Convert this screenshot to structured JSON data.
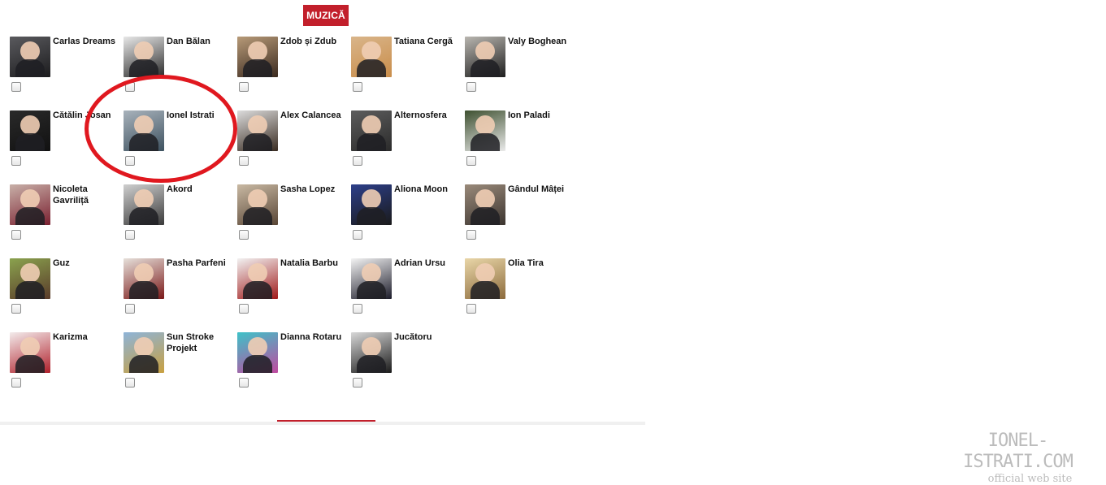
{
  "section": {
    "title": "MUZICĂ"
  },
  "artists": [
    {
      "name": "Carlas Dreams",
      "thumb": [
        "#5a5a5e",
        "#1c1c1e"
      ],
      "checked": false
    },
    {
      "name": "Dan Bălan",
      "thumb": [
        "#e8e8e8",
        "#2a2a2a"
      ],
      "checked": false
    },
    {
      "name": "Zdob și Zdub",
      "thumb": [
        "#b79a78",
        "#3b2a1f"
      ],
      "checked": false
    },
    {
      "name": "Tatiana Cergă",
      "thumb": [
        "#d9b58a",
        "#c98d4a"
      ],
      "checked": false
    },
    {
      "name": "Valy Boghean",
      "thumb": [
        "#b9b6b0",
        "#1e1e1e"
      ],
      "checked": false
    },
    {
      "name": "Cătălin Josan",
      "thumb": [
        "#2a2a2a",
        "#111111"
      ],
      "checked": false
    },
    {
      "name": "Ionel Istrati",
      "thumb": [
        "#a8b2bb",
        "#3e5260"
      ],
      "checked": false
    },
    {
      "name": "Alex Calancea",
      "thumb": [
        "#dcdcdc",
        "#3a2c22"
      ],
      "checked": false
    },
    {
      "name": "Alternosfera",
      "thumb": [
        "#5d5d5d",
        "#2b2b2b"
      ],
      "checked": false
    },
    {
      "name": "Ion Paladi",
      "thumb": [
        "#3e5030",
        "#eaeaea"
      ],
      "checked": false
    },
    {
      "name": "Nicoleta Gavriliță",
      "thumb": [
        "#c8b0a8",
        "#7a2030"
      ],
      "checked": false
    },
    {
      "name": "Akord",
      "thumb": [
        "#cfcfcf",
        "#3a3a3a"
      ],
      "checked": false
    },
    {
      "name": "Sasha Lopez",
      "thumb": [
        "#c9b9a3",
        "#594636"
      ],
      "checked": false
    },
    {
      "name": "Aliona Moon",
      "thumb": [
        "#2d3f8a",
        "#1a1a1a"
      ],
      "checked": false
    },
    {
      "name": "Gândul Mâței",
      "thumb": [
        "#9a8a7a",
        "#3c3530"
      ],
      "checked": false
    },
    {
      "name": "Guz",
      "thumb": [
        "#8aa24e",
        "#5a3b2a"
      ],
      "checked": false
    },
    {
      "name": "Pasha Parfeni",
      "thumb": [
        "#e6e0da",
        "#7a1818"
      ],
      "checked": false
    },
    {
      "name": "Natalia Barbu",
      "thumb": [
        "#f2f2f2",
        "#a01a1a"
      ],
      "checked": false
    },
    {
      "name": "Adrian Ursu",
      "thumb": [
        "#f4f4f4",
        "#1c1c2a"
      ],
      "checked": false
    },
    {
      "name": "Olia Tira",
      "thumb": [
        "#e9d6a8",
        "#8c6b3c"
      ],
      "checked": false
    },
    {
      "name": "Karizma",
      "thumb": [
        "#f3ecec",
        "#b0202b"
      ],
      "checked": false
    },
    {
      "name": "Sun Stroke Projekt",
      "thumb": [
        "#8eb4d8",
        "#c8a040"
      ],
      "checked": false
    },
    {
      "name": "Dianna Rotaru",
      "thumb": [
        "#3ec2c8",
        "#c04aa0"
      ],
      "checked": false
    },
    {
      "name": "Jucătoru",
      "thumb": [
        "#d8d8d8",
        "#1a1a1a"
      ],
      "checked": false
    }
  ],
  "watermark": {
    "site": "IONEL-ISTRATI.COM",
    "subtitle": "official web site"
  }
}
